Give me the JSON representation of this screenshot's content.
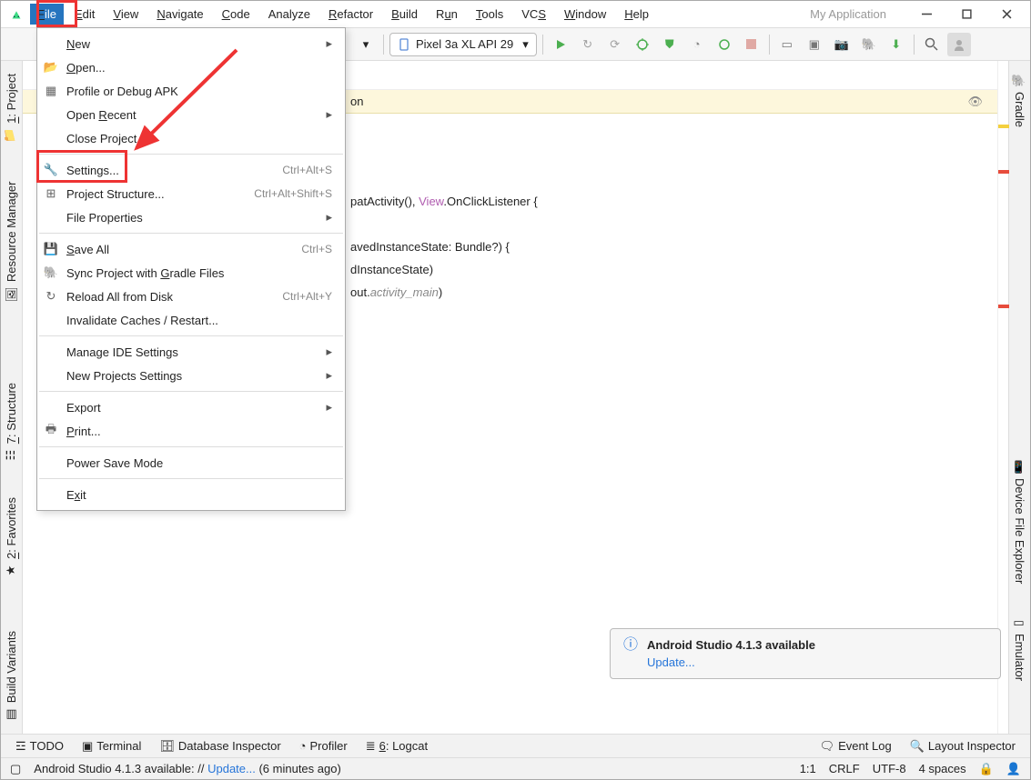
{
  "app_title": "My Application",
  "menubar": {
    "items": [
      {
        "label": "File",
        "mn": "F",
        "active": true
      },
      {
        "label": "Edit",
        "mn": "E"
      },
      {
        "label": "View",
        "mn": "V"
      },
      {
        "label": "Navigate",
        "mn": "N"
      },
      {
        "label": "Code",
        "mn": "C"
      },
      {
        "label": "Analyze"
      },
      {
        "label": "Refactor",
        "mn": "R"
      },
      {
        "label": "Build",
        "mn": "B"
      },
      {
        "label": "Run"
      },
      {
        "label": "Tools",
        "mn": "T"
      },
      {
        "label": "VCS",
        "mn": "S"
      },
      {
        "label": "Window",
        "mn": "W"
      },
      {
        "label": "Help",
        "mn": "H"
      }
    ]
  },
  "toolbar": {
    "device": "Pixel 3a XL API 29"
  },
  "file_menu": {
    "groups": [
      [
        {
          "label": "New",
          "mn": "N",
          "sub": true,
          "icon": ""
        },
        {
          "label": "Open...",
          "mn": "O",
          "icon": "folder"
        },
        {
          "label": "Profile or Debug APK",
          "icon": "app"
        },
        {
          "label": "Open Recent",
          "mn": "R",
          "sub": true,
          "icon": ""
        },
        {
          "label": "Close Project",
          "mn": "j",
          "icon": ""
        }
      ],
      [
        {
          "label": "Settings...",
          "mn": "",
          "shortcut": "Ctrl+Alt+S",
          "icon": "wrench"
        },
        {
          "label": "Project Structure...",
          "mn": "",
          "shortcut": "Ctrl+Alt+Shift+S",
          "icon": "structure"
        },
        {
          "label": "File Properties",
          "sub": true,
          "icon": ""
        }
      ],
      [
        {
          "label": "Save All",
          "mn": "S",
          "shortcut": "Ctrl+S",
          "icon": "save"
        },
        {
          "label": "Sync Project with Gradle Files",
          "mn": "G",
          "icon": "sync"
        },
        {
          "label": "Reload All from Disk",
          "shortcut": "Ctrl+Alt+Y",
          "icon": "reload"
        },
        {
          "label": "Invalidate Caches / Restart...",
          "icon": ""
        }
      ],
      [
        {
          "label": "Manage IDE Settings",
          "sub": true,
          "icon": ""
        },
        {
          "label": "New Projects Settings",
          "sub": true,
          "icon": ""
        }
      ],
      [
        {
          "label": "Export",
          "sub": true,
          "icon": ""
        },
        {
          "label": "Print...",
          "mn": "P",
          "disabled": true,
          "icon": "print"
        }
      ],
      [
        {
          "label": "Power Save Mode",
          "icon": ""
        }
      ],
      [
        {
          "label": "Exit",
          "mn": "x",
          "icon": ""
        }
      ]
    ]
  },
  "yellow_bar": {
    "text": "on"
  },
  "code": {
    "line1_a": "patActivity(), ",
    "line1_b": "View",
    "line1_c": ".OnClickListener {",
    "line2": "avedInstanceState: Bundle?) {",
    "line3": "dInstanceState)",
    "line4_a": "out.",
    "line4_b": "activity_main",
    "line4_c": ")"
  },
  "left_gutter": {
    "items": [
      {
        "label": "1: Project",
        "mn": "1"
      },
      {
        "label": "Resource Manager"
      },
      {
        "label": "7: Structure",
        "mn": "7"
      },
      {
        "label": "2: Favorites",
        "mn": "2"
      },
      {
        "label": "Build Variants"
      }
    ]
  },
  "right_gutter": {
    "items": [
      {
        "label": "Gradle"
      },
      {
        "label": "Device File Explorer"
      },
      {
        "label": "Emulator"
      }
    ]
  },
  "notification": {
    "title": "Android Studio 4.1.3 available",
    "link": "Update..."
  },
  "bottom_tools": {
    "items": [
      {
        "label": "TODO",
        "icon": "todo"
      },
      {
        "label": "Terminal",
        "icon": "terminal"
      },
      {
        "label": "Database Inspector",
        "icon": "db"
      },
      {
        "label": "Profiler",
        "icon": "profiler"
      },
      {
        "label": "6: Logcat",
        "mn": "6",
        "icon": "logcat"
      }
    ],
    "right": [
      {
        "label": "Event Log",
        "icon": "event"
      },
      {
        "label": "Layout Inspector",
        "icon": "layout"
      }
    ]
  },
  "statusbar": {
    "msg_a": "Android Studio 4.1.3 available: // ",
    "msg_b": "Update...",
    "msg_c": " (6 minutes ago)",
    "pos": "1:1",
    "eol": "CRLF",
    "enc": "UTF-8",
    "indent": "4 spaces"
  }
}
